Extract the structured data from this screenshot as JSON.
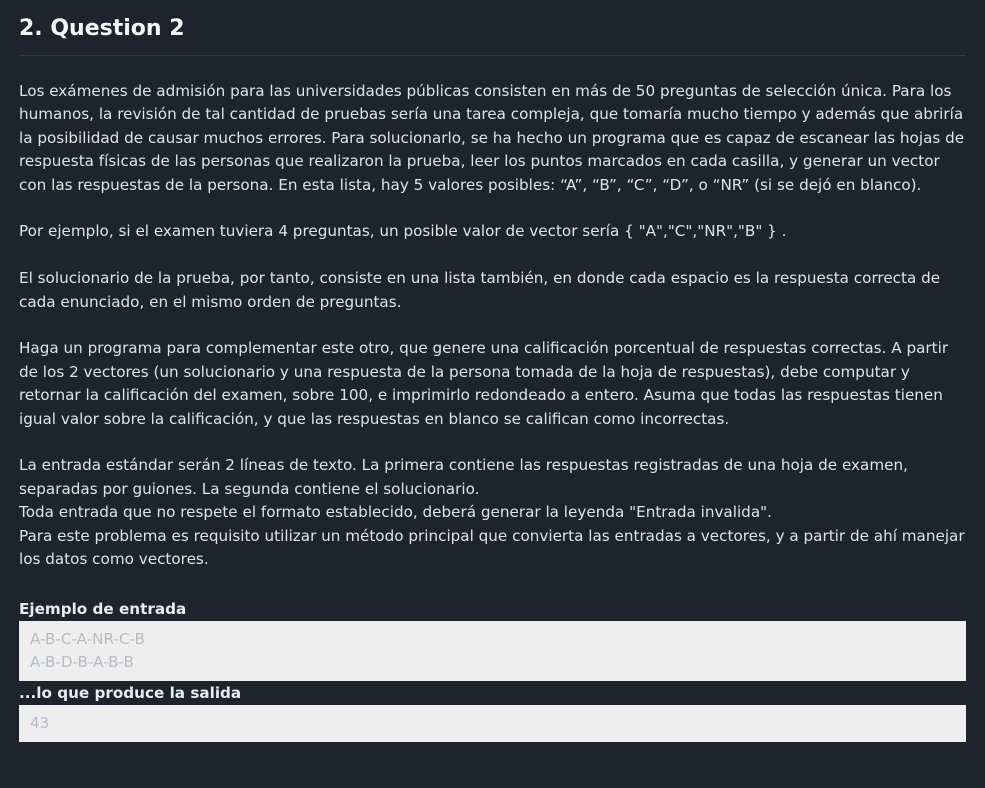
{
  "question": {
    "title": "2. Question 2",
    "paragraphs": [
      "Los exámenes de admisión para las universidades públicas consisten en más de 50 preguntas de selección única. Para los humanos, la revisión de tal cantidad de pruebas sería una tarea compleja, que tomaría mucho tiempo y además que abriría la posibilidad de causar muchos errores. Para solucionarlo, se ha hecho un programa que es capaz de escanear las hojas de respuesta físicas de las personas que realizaron la prueba, leer los puntos marcados en cada casilla, y generar un vector con las respuestas de la persona. En esta lista, hay 5 valores posibles: “A”, “B”, “C”, “D”, o “NR” (si se dejó en blanco).",
      "Por ejemplo, si el examen tuviera 4 preguntas, un posible valor de vector sería { \"A\",\"C\",\"NR\",\"B\" } .",
      "El solucionario de la prueba, por tanto, consiste en una lista también, en donde cada espacio es la respuesta correcta de cada enunciado, en el mismo orden de preguntas.",
      "Haga un programa para complementar este otro, que genere una calificación porcentual de respuestas correctas. A partir de los 2 vectores (un solucionario y una respuesta de la persona tomada de la hoja de respuestas), debe computar y retornar la calificación del examen, sobre 100, e imprimirlo redondeado a entero. Asuma que todas las respuestas tienen igual valor sobre la calificación, y que las respuestas en blanco se califican como incorrectas.",
      "La entrada estándar serán 2 líneas de texto. La primera contiene las respuestas registradas de una hoja de examen, separadas por guiones. La segunda contiene el solucionario.",
      "Toda entrada que no respete el formato establecido, deberá generar la leyenda \"Entrada invalida\".",
      "Para este problema es requisito utilizar un método principal que convierta las entradas a vectores, y a partir de ahí manejar los datos como vectores."
    ],
    "example_input_label": "Ejemplo de entrada",
    "example_input_lines": [
      "A-B-C-A-NR-C-B",
      "A-B-D-B-A-B-B"
    ],
    "example_output_label": "...lo que produce la salida",
    "example_output": "43"
  }
}
